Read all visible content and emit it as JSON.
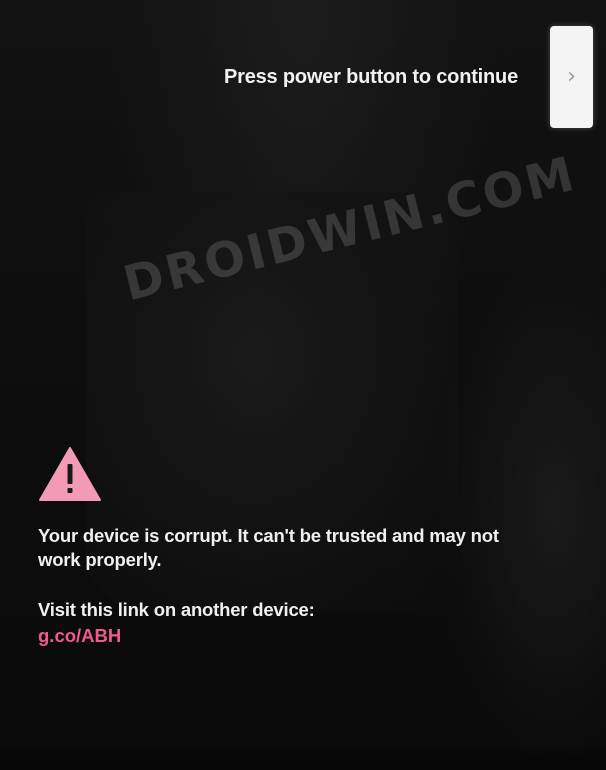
{
  "hint": {
    "text": "Press power button to continue"
  },
  "nav": {
    "next_icon": "chevron-right-icon",
    "next_glyph": "›"
  },
  "watermark": {
    "text": "DROIDWIN.COM"
  },
  "warning": {
    "icon": "warning-triangle-icon",
    "icon_color": "#f39bb4",
    "message": "Your device is corrupt. It can't be trusted and may not work properly.",
    "visit_text": "Visit this link on another device:",
    "link_text": "g.co/ABH",
    "link_color": "#ef5b8e"
  }
}
